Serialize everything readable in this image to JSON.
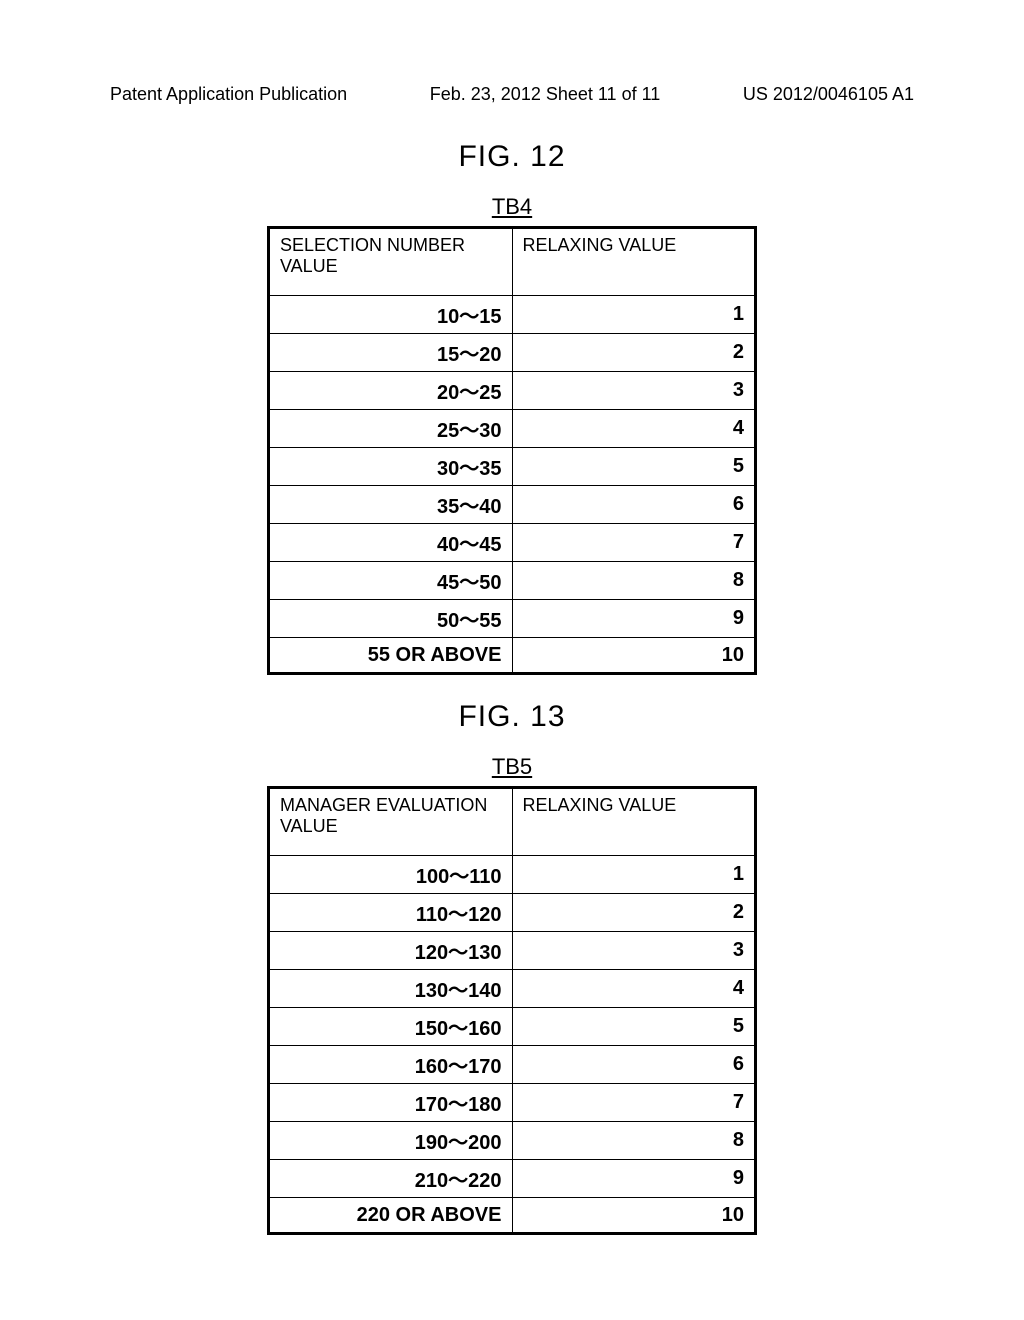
{
  "header": {
    "left": "Patent Application Publication",
    "center": "Feb. 23, 2012  Sheet 11 of 11",
    "right": "US 2012/0046105 A1"
  },
  "figure12": {
    "title": "FIG. 12",
    "tableLabel": "TB4",
    "headers": [
      "SELECTION NUMBER VALUE",
      "RELAXING VALUE"
    ],
    "rows": [
      [
        "10～15",
        "1"
      ],
      [
        "15～20",
        "2"
      ],
      [
        "20～25",
        "3"
      ],
      [
        "25～30",
        "4"
      ],
      [
        "30～35",
        "5"
      ],
      [
        "35～40",
        "6"
      ],
      [
        "40～45",
        "7"
      ],
      [
        "45～50",
        "8"
      ],
      [
        "50～55",
        "9"
      ],
      [
        "55 OR ABOVE",
        "10"
      ]
    ]
  },
  "figure13": {
    "title": "FIG. 13",
    "tableLabel": "TB5",
    "headers": [
      "MANAGER EVALUATION VALUE",
      "RELAXING VALUE"
    ],
    "rows": [
      [
        "100～110",
        "1"
      ],
      [
        "110～120",
        "2"
      ],
      [
        "120～130",
        "3"
      ],
      [
        "130～140",
        "4"
      ],
      [
        "150～160",
        "5"
      ],
      [
        "160～170",
        "6"
      ],
      [
        "170～180",
        "7"
      ],
      [
        "190～200",
        "8"
      ],
      [
        "210～220",
        "9"
      ],
      [
        "220 OR ABOVE",
        "10"
      ]
    ]
  }
}
